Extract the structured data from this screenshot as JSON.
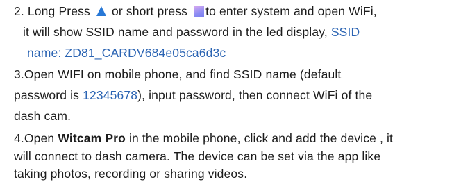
{
  "step2": {
    "l1a": "2. Long Press ",
    "up_icon": "up-triangle-icon",
    "l1b": " or short press ",
    "menu_icon": "menu-square-icon",
    "l1c": "to enter system and open WiFi,",
    "l2a": "it will show SSID name and password in the led display, ",
    "l2b": "SSID",
    "l3a": "name: ",
    "l3b": "ZD81_CARDV684e05ca6d3c"
  },
  "step3": {
    "l1": "3.Open WIFI on mobile phone, and find SSID name (default",
    "l2a": "password is ",
    "l2b": "12345678",
    "l2c": "), input password, then connect WiFi of the",
    "l3": "dash cam."
  },
  "step4": {
    "l1a": "4.Open ",
    "l1b": "Witcam Pro",
    "l1c": " in the mobile phone, click and add the device , it",
    "l2": "will connect to dash camera. The device can be set via the app like",
    "l3": "taking photos, recording or sharing videos."
  },
  "colors": {
    "text": "#1c1c1c",
    "highlight": "#2b64b3",
    "up_icon": "#2878d6",
    "menu_icon": "#8e8df3"
  }
}
